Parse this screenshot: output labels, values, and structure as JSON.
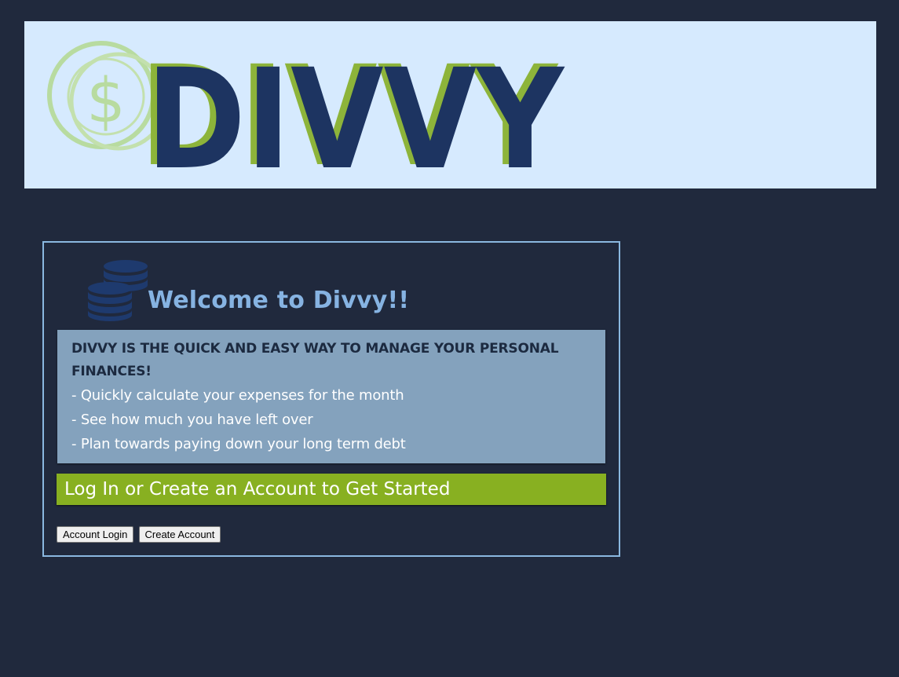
{
  "banner": {
    "logo_text": "DIVVY",
    "logo_symbol": "$",
    "colors": {
      "background": "#d6eafe",
      "logo_primary": "#1d3461",
      "logo_shadow": "#8db43a",
      "coin_outline": "#b8dba0"
    }
  },
  "card": {
    "title": "Welcome to Divvy!!",
    "headline": "DIVVY IS THE QUICK AND EASY WAY TO MANAGE YOUR PERSONAL FINANCES!",
    "bullets": [
      "- Quickly calculate your expenses for the month",
      "- See how much you have left over",
      "- Plan towards paying down your long term debt"
    ],
    "cta": "Log In or Create an Account to Get Started",
    "buttons": {
      "login": "Account Login",
      "create": "Create Account"
    },
    "colors": {
      "title": "#86b3e2",
      "info_bg": "#84a2bd",
      "cta_bg": "#88b021",
      "border": "#8ab8e0",
      "page_bg": "#20293d"
    }
  },
  "icons": {
    "banner_coin": "dollar-coin-icon",
    "welcome_coins": "coin-stack-icon"
  }
}
